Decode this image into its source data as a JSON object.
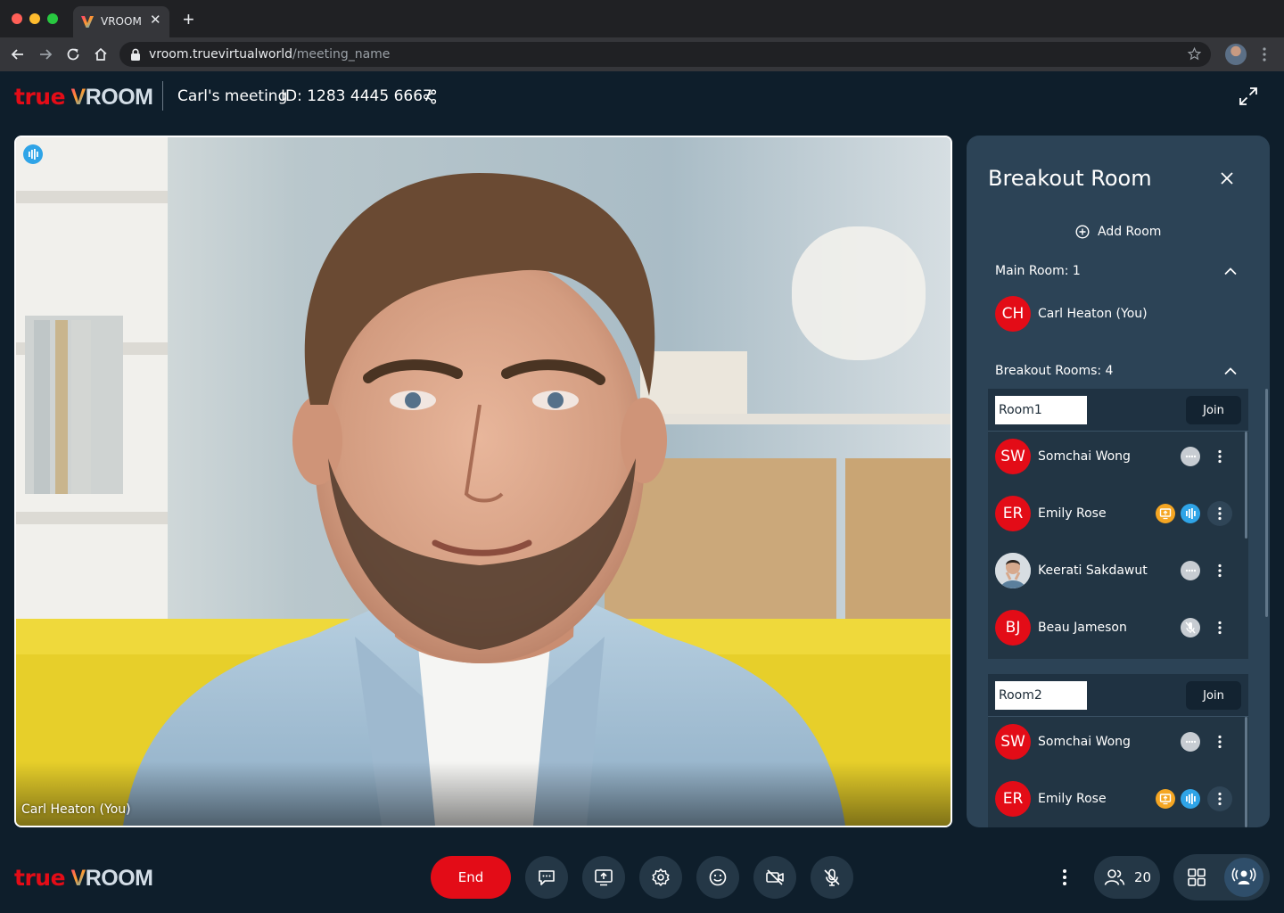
{
  "browser": {
    "tab_title": "VROOM",
    "url_host": "vroom.truevirtualworld",
    "url_path": "/meeting_name",
    "traffic_colors": [
      "#ff5f57",
      "#febc2e",
      "#28c840"
    ]
  },
  "app": {
    "logo_true": "true",
    "logo_v": "V",
    "logo_room": "ROOM",
    "meeting_title": "Carl's meeting",
    "meeting_id": "ID: 1283 4445 6667",
    "brand_red": "#e30c17"
  },
  "video": {
    "participant_label": "Carl Heaton (You)"
  },
  "panel": {
    "title": "Breakout Room",
    "add_room_label": "Add Room",
    "main_room": {
      "label": "Main Room: 1",
      "members": [
        {
          "initials": "CH",
          "name": "Carl Heaton (You)"
        }
      ]
    },
    "breakout_rooms": {
      "label": "Breakout Rooms: 4",
      "rooms": [
        {
          "name": "Room1",
          "join_label": "Join",
          "members": [
            {
              "initials": "SW",
              "name": "Somchai Wong",
              "status": [
                "muted-dots"
              ]
            },
            {
              "initials": "ER",
              "name": "Emily Rose",
              "status": [
                "presenting",
                "speaking"
              ]
            },
            {
              "initials": "",
              "name": "Keerati Sakdawut",
              "status": [
                "muted-dots"
              ],
              "photo": true
            },
            {
              "initials": "BJ",
              "name": "Beau Jameson",
              "status": [
                "mic-off"
              ]
            }
          ]
        },
        {
          "name": "Room2",
          "join_label": "Join",
          "members": [
            {
              "initials": "SW",
              "name": "Somchai Wong",
              "status": [
                "muted-dots"
              ]
            },
            {
              "initials": "ER",
              "name": "Emily Rose",
              "status": [
                "presenting",
                "speaking"
              ]
            }
          ]
        }
      ]
    }
  },
  "controls": {
    "end_label": "End",
    "participant_count": "20",
    "icons": [
      "chat-icon",
      "share-screen-icon",
      "settings-icon",
      "emoji-icon",
      "camera-off-icon",
      "mic-off-icon"
    ]
  }
}
